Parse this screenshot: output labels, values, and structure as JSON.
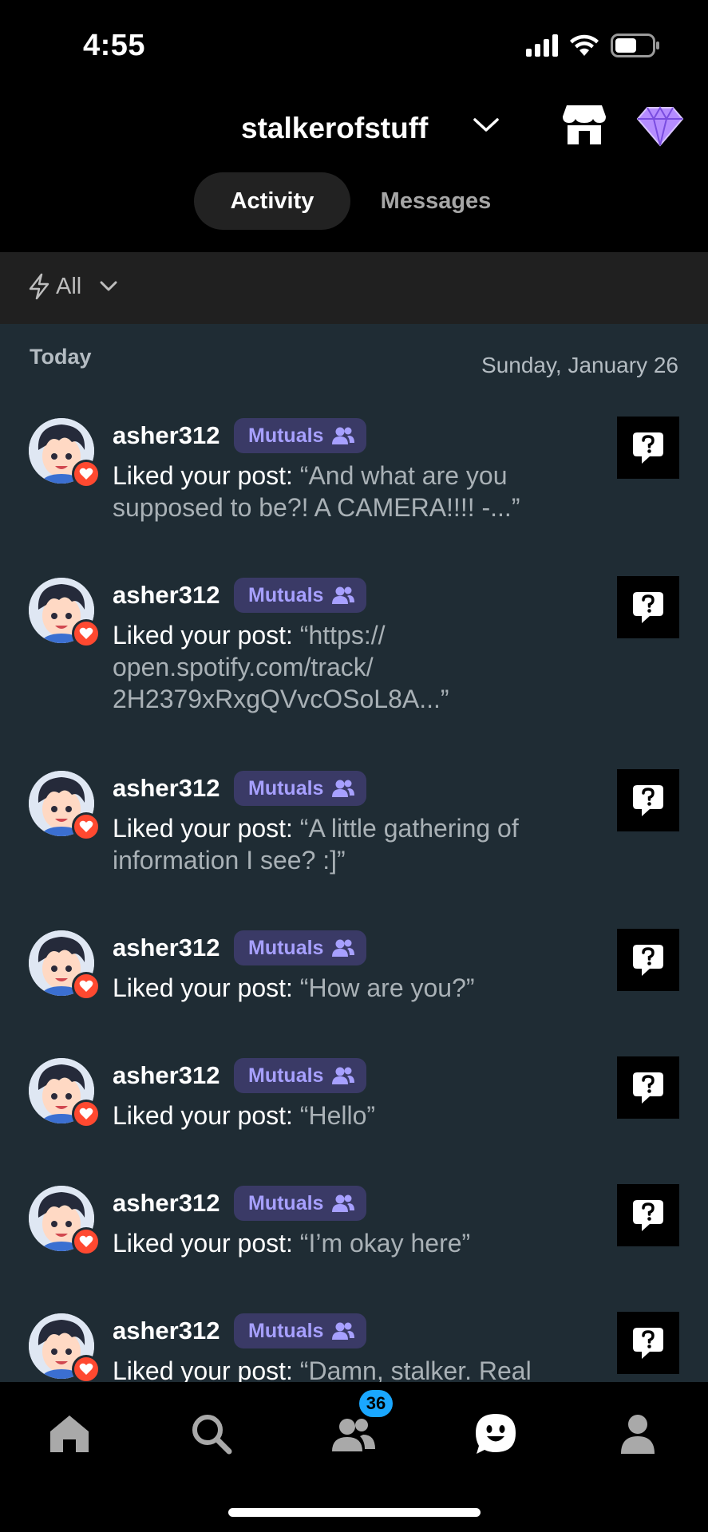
{
  "status_bar": {
    "time": "4:55"
  },
  "header": {
    "blog_name": "stalkerofstuff"
  },
  "tabs": [
    {
      "label": "Activity",
      "active": true
    },
    {
      "label": "Messages",
      "active": false
    }
  ],
  "filter": {
    "label": "All"
  },
  "feed": {
    "section_label": "Today",
    "date": "Sunday, January 26",
    "items": [
      {
        "username": "asher312",
        "badge": "Mutuals",
        "action": "Liked your post: ",
        "quote": "“And what are you supposed to be?!  A CAMERA!!!! -...”"
      },
      {
        "username": "asher312",
        "badge": "Mutuals",
        "action": "Liked your post: ",
        "quote": "“https:// open.spotify.com/track/ 2H2379xRxgQVvcOSoL8A...”"
      },
      {
        "username": "asher312",
        "badge": "Mutuals",
        "action": "Liked your post: ",
        "quote": "“A little gathering of information I see? :]”"
      },
      {
        "username": "asher312",
        "badge": "Mutuals",
        "action": "Liked your post: ",
        "quote": "“How are you?”"
      },
      {
        "username": "asher312",
        "badge": "Mutuals",
        "action": "Liked your post: ",
        "quote": "“Hello”"
      },
      {
        "username": "asher312",
        "badge": "Mutuals",
        "action": "Liked your post: ",
        "quote": "“I’m okay here”"
      },
      {
        "username": "asher312",
        "badge": "Mutuals",
        "action": "Liked your post: ",
        "quote": "“Damn, stalker. Real"
      }
    ]
  },
  "bottom_nav": {
    "items": [
      "home-icon",
      "search-icon",
      "people-icon",
      "activity-smiley-icon",
      "account-icon"
    ],
    "people_badge": "36"
  },
  "colors": {
    "feed_bg": "#1f2c34",
    "mutuals_bg": "#3a3a66",
    "mutuals_text": "#a7a0ff",
    "like_red": "#ff4930",
    "badge_blue": "#1aa7ff"
  }
}
